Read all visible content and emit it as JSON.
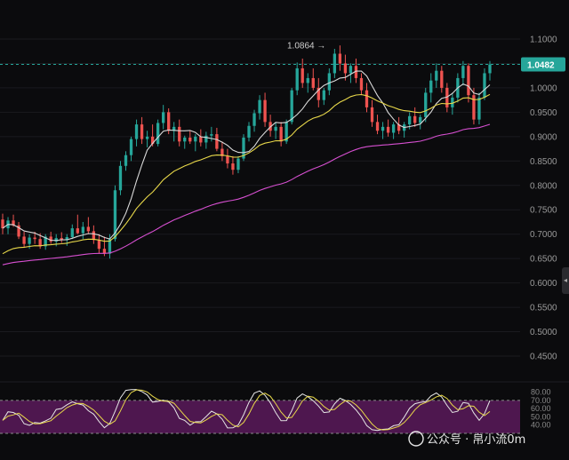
{
  "chart_data": {
    "type": "candlestick",
    "title": "",
    "price_axis": {
      "ticks": [
        "1.1000",
        "1.0500",
        "1.0000",
        "0.9500",
        "0.9000",
        "0.8500",
        "0.8000",
        "0.7500",
        "0.7000",
        "0.6500",
        "0.6000",
        "0.5500",
        "0.5000",
        "0.4500"
      ],
      "range": [
        0.4,
        1.12
      ]
    },
    "current_price": {
      "label": "1.0482",
      "value": 1.0482,
      "color": "#26a69a"
    },
    "high_marker": {
      "label": "1.0864 →",
      "value": 1.0864
    },
    "colors": {
      "up": "#26a69a",
      "down": "#ef5350",
      "ma_fast": "#d9d9d9",
      "ma_mid": "#e8d84a",
      "ma_slow": "#d64fd0",
      "rsi_band": "#5a1a5c"
    },
    "candles": [
      [
        0.73,
        0.742,
        0.7,
        0.712
      ],
      [
        0.712,
        0.735,
        0.7,
        0.728
      ],
      [
        0.728,
        0.74,
        0.715,
        0.718
      ],
      [
        0.718,
        0.725,
        0.69,
        0.695
      ],
      [
        0.695,
        0.705,
        0.672,
        0.68
      ],
      [
        0.68,
        0.7,
        0.67,
        0.693
      ],
      [
        0.693,
        0.705,
        0.68,
        0.69
      ],
      [
        0.69,
        0.702,
        0.67,
        0.675
      ],
      [
        0.675,
        0.7,
        0.668,
        0.695
      ],
      [
        0.695,
        0.705,
        0.68,
        0.685
      ],
      [
        0.685,
        0.7,
        0.675,
        0.692
      ],
      [
        0.692,
        0.704,
        0.682,
        0.688
      ],
      [
        0.688,
        0.7,
        0.676,
        0.694
      ],
      [
        0.694,
        0.72,
        0.69,
        0.712
      ],
      [
        0.712,
        0.74,
        0.7,
        0.702
      ],
      [
        0.702,
        0.725,
        0.69,
        0.715
      ],
      [
        0.715,
        0.735,
        0.7,
        0.706
      ],
      [
        0.706,
        0.718,
        0.68,
        0.688
      ],
      [
        0.688,
        0.7,
        0.66,
        0.67
      ],
      [
        0.67,
        0.695,
        0.655,
        0.66
      ],
      [
        0.66,
        0.7,
        0.65,
        0.69
      ],
      [
        0.69,
        0.8,
        0.685,
        0.79
      ],
      [
        0.79,
        0.85,
        0.78,
        0.84
      ],
      [
        0.84,
        0.87,
        0.83,
        0.862
      ],
      [
        0.862,
        0.9,
        0.85,
        0.895
      ],
      [
        0.895,
        0.935,
        0.88,
        0.925
      ],
      [
        0.925,
        0.94,
        0.885,
        0.895
      ],
      [
        0.895,
        0.912,
        0.878,
        0.9
      ],
      [
        0.9,
        0.925,
        0.88,
        0.885
      ],
      [
        0.885,
        0.935,
        0.88,
        0.928
      ],
      [
        0.928,
        0.965,
        0.915,
        0.95
      ],
      [
        0.95,
        0.958,
        0.905,
        0.912
      ],
      [
        0.912,
        0.93,
        0.89,
        0.92
      ],
      [
        0.92,
        0.935,
        0.88,
        0.89
      ],
      [
        0.89,
        0.902,
        0.875,
        0.898
      ],
      [
        0.898,
        0.912,
        0.885,
        0.89
      ],
      [
        0.89,
        0.905,
        0.87,
        0.9
      ],
      [
        0.9,
        0.915,
        0.88,
        0.888
      ],
      [
        0.888,
        0.91,
        0.875,
        0.902
      ],
      [
        0.902,
        0.92,
        0.89,
        0.905
      ],
      [
        0.905,
        0.918,
        0.87,
        0.875
      ],
      [
        0.875,
        0.89,
        0.85,
        0.86
      ],
      [
        0.86,
        0.875,
        0.835,
        0.845
      ],
      [
        0.845,
        0.86,
        0.822,
        0.832
      ],
      [
        0.832,
        0.86,
        0.825,
        0.855
      ],
      [
        0.855,
        0.905,
        0.85,
        0.898
      ],
      [
        0.898,
        0.93,
        0.89,
        0.922
      ],
      [
        0.922,
        0.955,
        0.91,
        0.948
      ],
      [
        0.948,
        0.985,
        0.935,
        0.975
      ],
      [
        0.975,
        0.99,
        0.92,
        0.93
      ],
      [
        0.93,
        0.945,
        0.9,
        0.912
      ],
      [
        0.912,
        0.928,
        0.895,
        0.92
      ],
      [
        0.92,
        0.93,
        0.88,
        0.89
      ],
      [
        0.89,
        0.935,
        0.885,
        0.93
      ],
      [
        0.93,
        1.0,
        0.925,
        0.995
      ],
      [
        0.995,
        1.052,
        0.985,
        1.04
      ],
      [
        1.04,
        1.06,
        1.0,
        1.01
      ],
      [
        1.01,
        1.03,
        0.99,
        1.02
      ],
      [
        1.02,
        1.04,
        0.995,
        1.0
      ],
      [
        1.0,
        1.02,
        0.96,
        0.975
      ],
      [
        0.975,
        1.0,
        0.965,
        0.995
      ],
      [
        0.995,
        1.04,
        0.985,
        1.03
      ],
      [
        1.03,
        1.08,
        1.02,
        1.07
      ],
      [
        1.07,
        1.087,
        1.035,
        1.05
      ],
      [
        1.05,
        1.068,
        1.015,
        1.03
      ],
      [
        1.03,
        1.05,
        1.01,
        1.045
      ],
      [
        1.045,
        1.06,
        1.01,
        1.02
      ],
      [
        1.02,
        1.03,
        0.985,
        0.995
      ],
      [
        0.995,
        1.01,
        0.95,
        0.96
      ],
      [
        0.96,
        0.975,
        0.92,
        0.93
      ],
      [
        0.93,
        0.945,
        0.905,
        0.912
      ],
      [
        0.912,
        0.93,
        0.895,
        0.92
      ],
      [
        0.92,
        0.935,
        0.9,
        0.908
      ],
      [
        0.908,
        0.93,
        0.895,
        0.925
      ],
      [
        0.925,
        0.94,
        0.905,
        0.912
      ],
      [
        0.912,
        0.93,
        0.898,
        0.925
      ],
      [
        0.925,
        0.95,
        0.915,
        0.942
      ],
      [
        0.942,
        0.96,
        0.92,
        0.928
      ],
      [
        0.928,
        0.945,
        0.915,
        0.94
      ],
      [
        0.94,
        1.0,
        0.93,
        0.99
      ],
      [
        0.99,
        1.03,
        0.97,
        1.015
      ],
      [
        1.015,
        1.05,
        1.0,
        1.035
      ],
      [
        1.035,
        1.045,
        0.99,
        1.0
      ],
      [
        1.0,
        1.01,
        0.95,
        0.96
      ],
      [
        0.96,
        0.99,
        0.945,
        0.98
      ],
      [
        0.98,
        1.03,
        0.97,
        1.02
      ],
      [
        1.02,
        1.055,
        1.005,
        1.045
      ],
      [
        1.045,
        1.05,
        0.97,
        0.985
      ],
      [
        0.985,
        1.0,
        0.925,
        0.935
      ],
      [
        0.935,
        0.99,
        0.925,
        0.98
      ],
      [
        0.98,
        1.04,
        0.975,
        1.03
      ],
      [
        1.03,
        1.055,
        1.015,
        1.048
      ]
    ],
    "rsi_axis": {
      "ticks": [
        "80.00",
        "70.00",
        "60.00",
        "50.00",
        "40.00"
      ],
      "range": [
        30,
        85
      ],
      "band": [
        30,
        70
      ]
    }
  },
  "watermark": {
    "text": "公众号 · 帛小流0m"
  },
  "side_handle": {
    "icon": "chevron-left-icon",
    "glyph": "◂"
  }
}
